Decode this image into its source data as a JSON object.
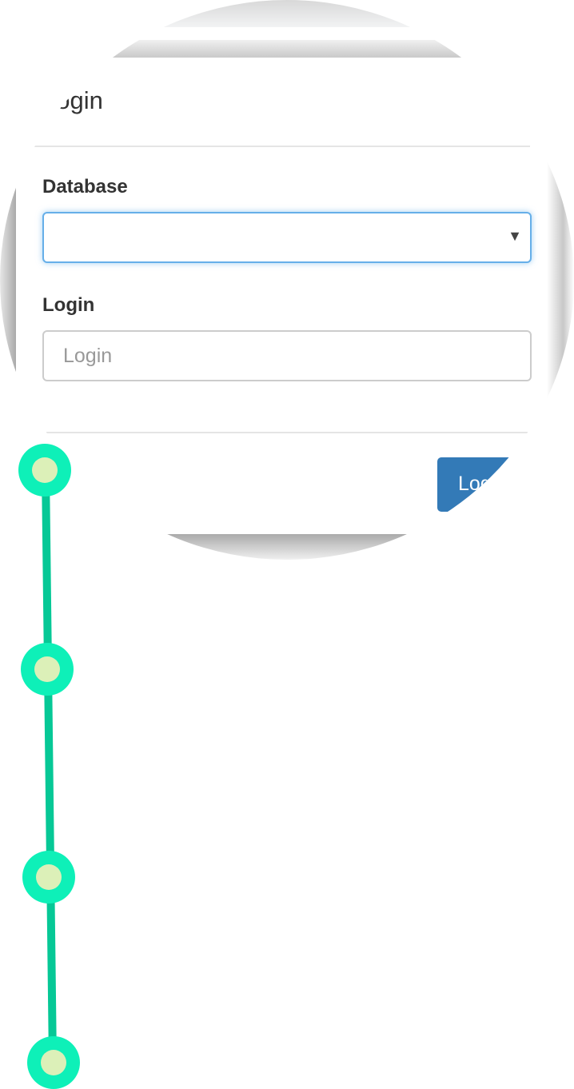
{
  "dialog": {
    "title": "Login",
    "database_label": "Database",
    "database_value": "",
    "login_label": "Login",
    "login_placeholder": "Login",
    "login_button": "Login"
  },
  "icons": {
    "dropdown": "caret-down-icon"
  },
  "colors": {
    "primary": "#337ab7",
    "timeline_node": "#0ef0b8",
    "timeline_line": "#06c896",
    "node_center": "#dcf0b8"
  },
  "timeline": {
    "steps": 4
  }
}
